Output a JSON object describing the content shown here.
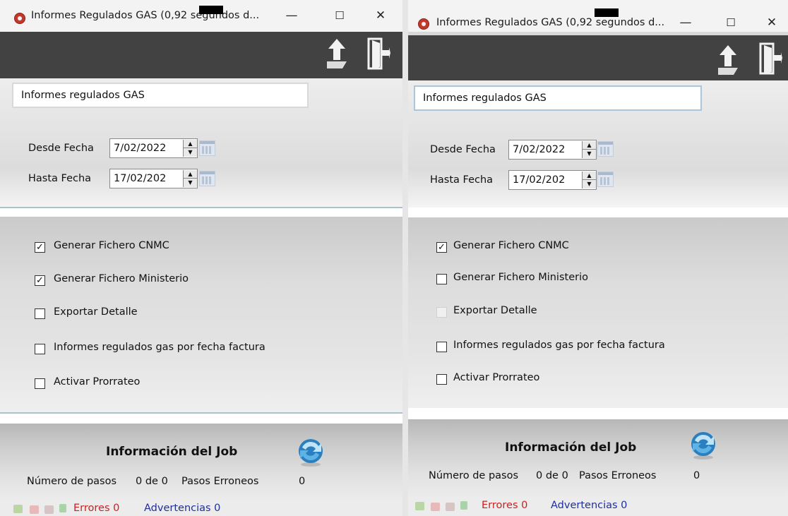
{
  "windows": [
    {
      "title": "Informes Regulados GAS (0,92 segundos d...",
      "report_name": "Informes regulados GAS",
      "desde_label": "Desde Fecha",
      "desde_value": "7/02/2022",
      "hasta_label": "Hasta Fecha",
      "hasta_value": "17/02/202",
      "options": [
        {
          "label": "Generar Fichero CNMC",
          "checked": true,
          "enabled": true
        },
        {
          "label": "Generar Fichero Ministerio",
          "checked": true,
          "enabled": true
        },
        {
          "label": "Exportar Detalle",
          "checked": false,
          "enabled": true
        },
        {
          "label": "Informes regulados gas por fecha factura",
          "checked": false,
          "enabled": true
        },
        {
          "label": "Activar Prorrateo",
          "checked": false,
          "enabled": true
        }
      ],
      "job": {
        "title": "Información del Job",
        "steps_label": "Número de pasos",
        "steps_value": "0 de 0",
        "errors_label": "Pasos Erroneos",
        "errors_value": "0"
      },
      "status": {
        "errors": "Errores 0",
        "warnings": "Advertencias 0"
      }
    },
    {
      "title": "Informes Regulados GAS (0,92 segundos d...",
      "report_name": "Informes regulados GAS",
      "desde_label": "Desde Fecha",
      "desde_value": "7/02/2022",
      "hasta_label": "Hasta Fecha",
      "hasta_value": "17/02/202",
      "options": [
        {
          "label": "Generar Fichero CNMC",
          "checked": true,
          "enabled": true
        },
        {
          "label": "Generar Fichero Ministerio",
          "checked": false,
          "enabled": true
        },
        {
          "label": "Exportar Detalle",
          "checked": false,
          "enabled": false
        },
        {
          "label": "Informes regulados gas por fecha factura",
          "checked": false,
          "enabled": true
        },
        {
          "label": "Activar Prorrateo",
          "checked": false,
          "enabled": true
        }
      ],
      "job": {
        "title": "Información del Job",
        "steps_label": "Número de pasos",
        "steps_value": "0 de 0",
        "errors_label": "Pasos Erroneos",
        "errors_value": "0"
      },
      "status": {
        "errors": "Errores 0",
        "warnings": "Advertencias 0"
      }
    }
  ],
  "colors": {
    "toolbar": "#424242",
    "error_text": "#cc1f1f",
    "warning_text": "#1f2f99",
    "app_icon": "#c0392b"
  },
  "icons": {
    "toolbar": [
      "upload-arrow-icon",
      "exit-door-icon"
    ],
    "job": "refresh-job-icon",
    "status": [
      "add-icon",
      "copy-icon",
      "delete-icon",
      "up-arrow-icon"
    ]
  }
}
